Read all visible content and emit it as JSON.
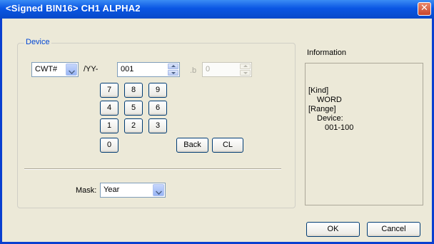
{
  "window": {
    "title": "<Signed BIN16> CH1 ALPHA2",
    "close_glyph": "✕"
  },
  "device": {
    "legend": "Device",
    "type_value": "CWT#",
    "separator_label": "/YY-",
    "number_value": "001",
    "bit_label": ".b",
    "bit_value": "0"
  },
  "keypad": {
    "keys": [
      "7",
      "8",
      "9",
      "4",
      "5",
      "6",
      "1",
      "2",
      "3",
      "0"
    ],
    "back_label": "Back",
    "clear_label": "CL"
  },
  "mask": {
    "label": "Mask:",
    "value": "Year"
  },
  "information": {
    "heading": "Information",
    "kind_label": "[Kind]",
    "kind_value": "WORD",
    "range_label": "[Range]",
    "device_label": "Device:",
    "device_range": "001-100"
  },
  "footer": {
    "ok_label": "OK",
    "cancel_label": "Cancel"
  },
  "colors": {
    "title_bar": "#0a56e3",
    "legend_text": "#0046d5",
    "dialog_bg": "#ece9d8",
    "close_button": "#c8452c"
  },
  "icons": {
    "dropdown": "chevron-down-icon",
    "spinner": "spinner-arrows-icon",
    "close": "close-icon"
  }
}
